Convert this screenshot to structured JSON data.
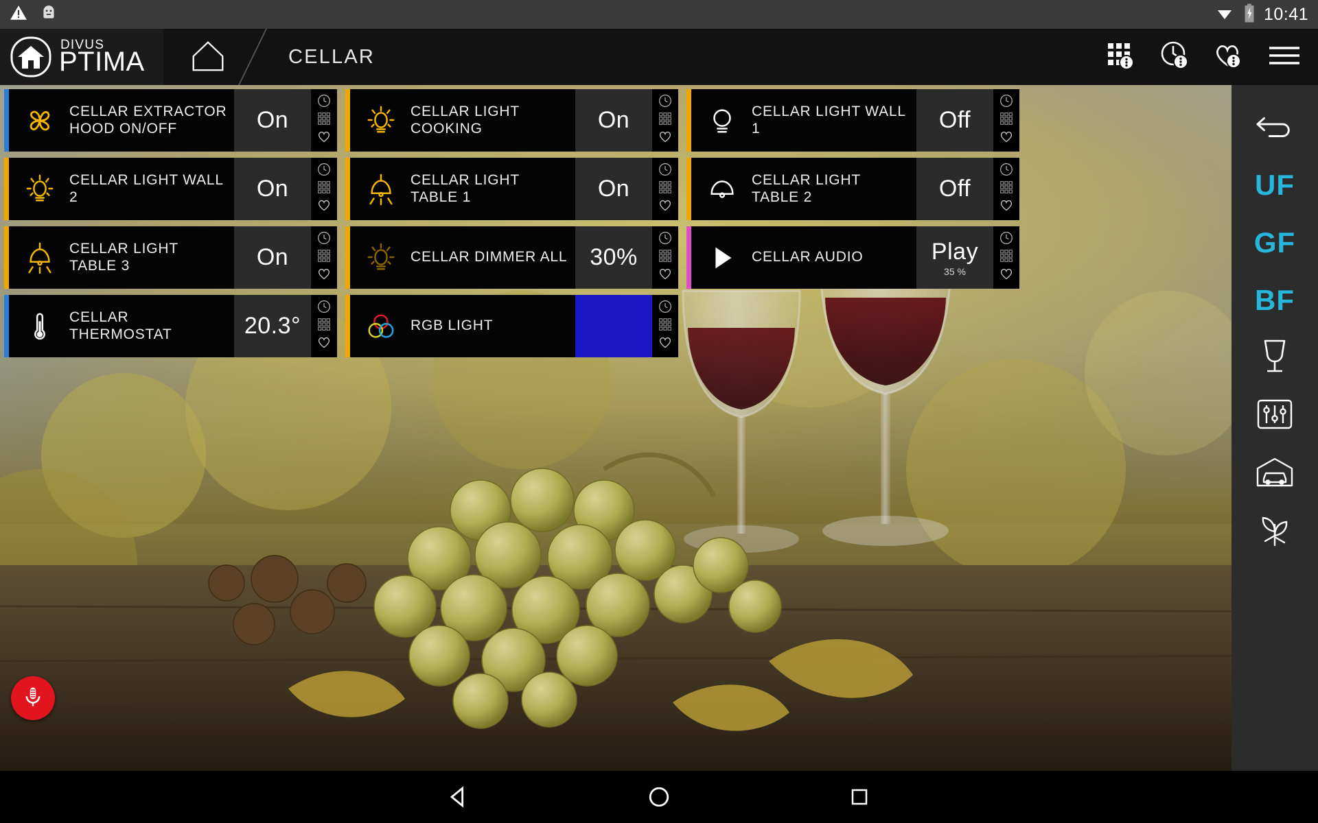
{
  "statusbar": {
    "time": "10:41",
    "icons": [
      "warning-icon",
      "android-robot-icon",
      "wifi-icon",
      "battery-charging-icon"
    ]
  },
  "header": {
    "brand_top": "DIVUS",
    "brand_bottom": "PTIMA",
    "home_icon": "home-icon",
    "breadcrumb": "CELLAR",
    "icons": [
      "scenes-grid-icon",
      "timer-clock-icon",
      "favorites-heart-icon",
      "hamburger-menu-icon"
    ]
  },
  "colors": {
    "accent_blue": "#2a7fd4",
    "accent_orange": "#f0a800",
    "accent_magenta": "#e04ec7",
    "icon_yellow": "#f5b400",
    "icon_yellow_dim": "#8a6300",
    "cyan": "#27b7dd",
    "rgb_swatch": "#1b17c4",
    "mic_red": "#e2151f"
  },
  "tiles": [
    {
      "name": "cellar-extractor-hood",
      "label": "CELLAR EXTRACTOR HOOD ON/OFF",
      "icon": "fan-icon",
      "value": "On",
      "sub": "",
      "accent": "blue",
      "icon_state": "on"
    },
    {
      "name": "cellar-light-cooking",
      "label": "CELLAR LIGHT COOKING",
      "icon": "bulb-rays-icon",
      "value": "On",
      "sub": "",
      "accent": "orange",
      "icon_state": "on"
    },
    {
      "name": "cellar-light-wall-1",
      "label": "CELLAR LIGHT WALL 1",
      "icon": "bulb-plain-icon",
      "value": "Off",
      "sub": "",
      "accent": "orange",
      "icon_state": "off"
    },
    {
      "name": "cellar-light-wall-2",
      "label": "CELLAR LIGHT WALL 2",
      "icon": "bulb-rays-icon",
      "value": "On",
      "sub": "",
      "accent": "orange",
      "icon_state": "on"
    },
    {
      "name": "cellar-light-table-1",
      "label": "CELLAR LIGHT TABLE 1",
      "icon": "pendant-lamp-rays-icon",
      "value": "On",
      "sub": "",
      "accent": "orange",
      "icon_state": "on"
    },
    {
      "name": "cellar-light-table-2",
      "label": "CELLAR LIGHT TABLE 2",
      "icon": "pendant-lamp-icon",
      "value": "Off",
      "sub": "",
      "accent": "orange",
      "icon_state": "off"
    },
    {
      "name": "cellar-light-table-3",
      "label": "CELLAR LIGHT TABLE 3",
      "icon": "pendant-lamp-rays-icon",
      "value": "On",
      "sub": "",
      "accent": "orange",
      "icon_state": "on"
    },
    {
      "name": "cellar-dimmer-all",
      "label": "CELLAR DIMMER ALL",
      "icon": "bulb-rays-icon",
      "value": "30%",
      "sub": "",
      "accent": "orange",
      "icon_state": "dim"
    },
    {
      "name": "cellar-audio",
      "label": "CELLAR AUDIO",
      "icon": "play-icon",
      "value": "Play",
      "sub": "35 %",
      "accent": "magenta",
      "icon_state": "white"
    },
    {
      "name": "cellar-thermostat",
      "label": "CELLAR THERMOSTAT",
      "icon": "thermometer-icon",
      "value": "20.3°",
      "sub": "",
      "accent": "blue",
      "icon_state": "white"
    },
    {
      "name": "rgb-light",
      "label": "RGB LIGHT",
      "icon": "rgb-circles-icon",
      "value": "",
      "sub": "",
      "accent": "orange",
      "icon_state": "rgb",
      "value_swatch": true
    }
  ],
  "tile_side_icons": [
    "schedule-clock-icon",
    "keypad-grid-icon",
    "favorite-heart-icon"
  ],
  "sidebar": [
    {
      "name": "back-button",
      "type": "icon",
      "icon": "back-arrow-icon",
      "label": ""
    },
    {
      "name": "floor-uf",
      "type": "text",
      "icon": "",
      "label": "UF"
    },
    {
      "name": "floor-gf",
      "type": "text",
      "icon": "",
      "label": "GF"
    },
    {
      "name": "floor-bf",
      "type": "text",
      "icon": "",
      "label": "BF"
    },
    {
      "name": "cellar-wine-glass",
      "type": "icon",
      "icon": "wine-glass-icon",
      "label": ""
    },
    {
      "name": "settings-sliders",
      "type": "icon",
      "icon": "sliders-icon",
      "label": ""
    },
    {
      "name": "garage-car",
      "type": "icon",
      "icon": "car-garage-icon",
      "label": ""
    },
    {
      "name": "garden-plant",
      "type": "icon",
      "icon": "plant-irrigation-icon",
      "label": ""
    }
  ],
  "mic": {
    "name": "voice-control-button",
    "icon": "microphone-icon"
  },
  "navbar": [
    "back-triangle-icon",
    "home-circle-icon",
    "recents-square-icon"
  ]
}
